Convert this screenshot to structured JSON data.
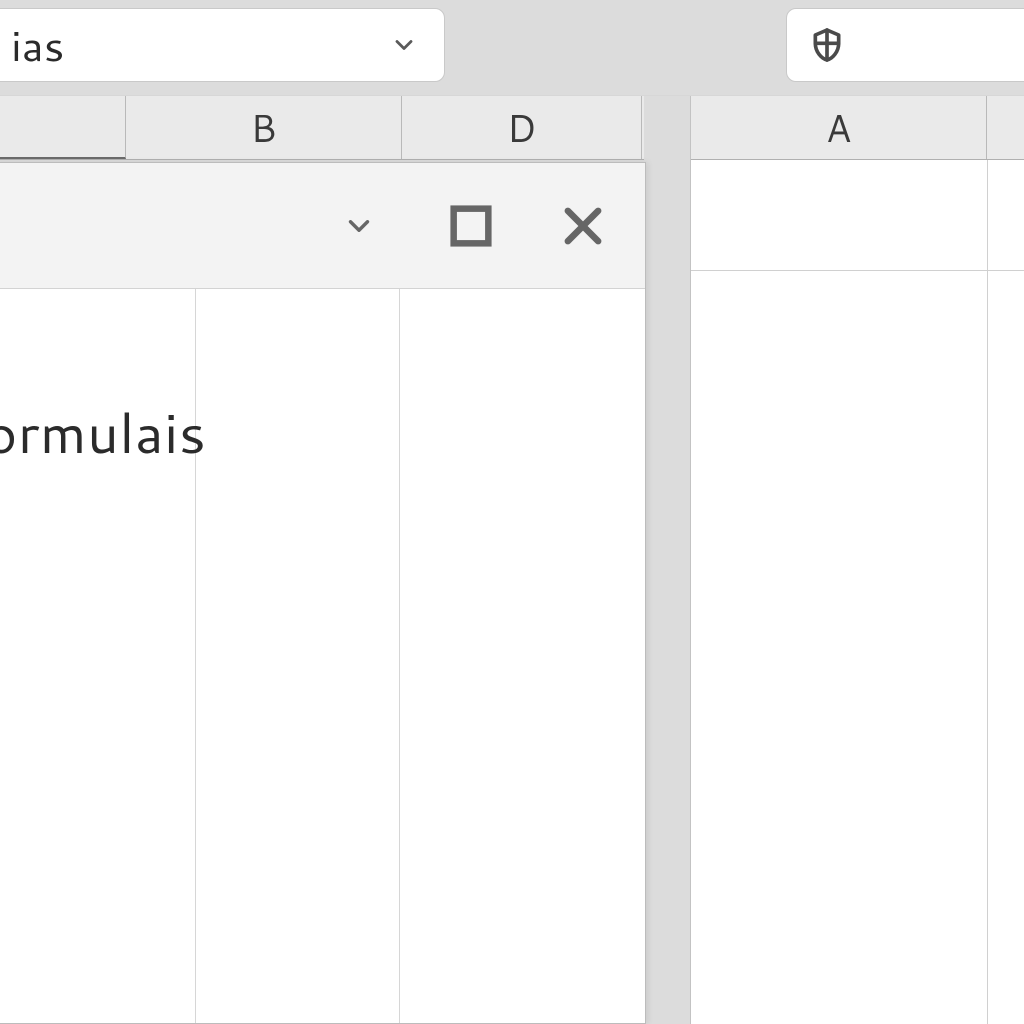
{
  "toolbar": {
    "left_dropdown_label": "ias",
    "right_dropdown_icon": "shield-icon"
  },
  "sheet_left": {
    "column_headers": [
      "",
      "B",
      "D"
    ]
  },
  "sheet_right": {
    "column_headers": [
      "A"
    ]
  },
  "dialog": {
    "title_fragment": "ormulais",
    "window_controls": {
      "minimize_icon": "chevron-down-icon",
      "maximize_icon": "square-icon",
      "close_icon": "close-icon"
    }
  },
  "colors": {
    "bg": "#dcdcdc",
    "panel": "#ffffff",
    "header": "#eaeaea",
    "border": "#c3c3c3",
    "text": "#2b2b2b"
  }
}
